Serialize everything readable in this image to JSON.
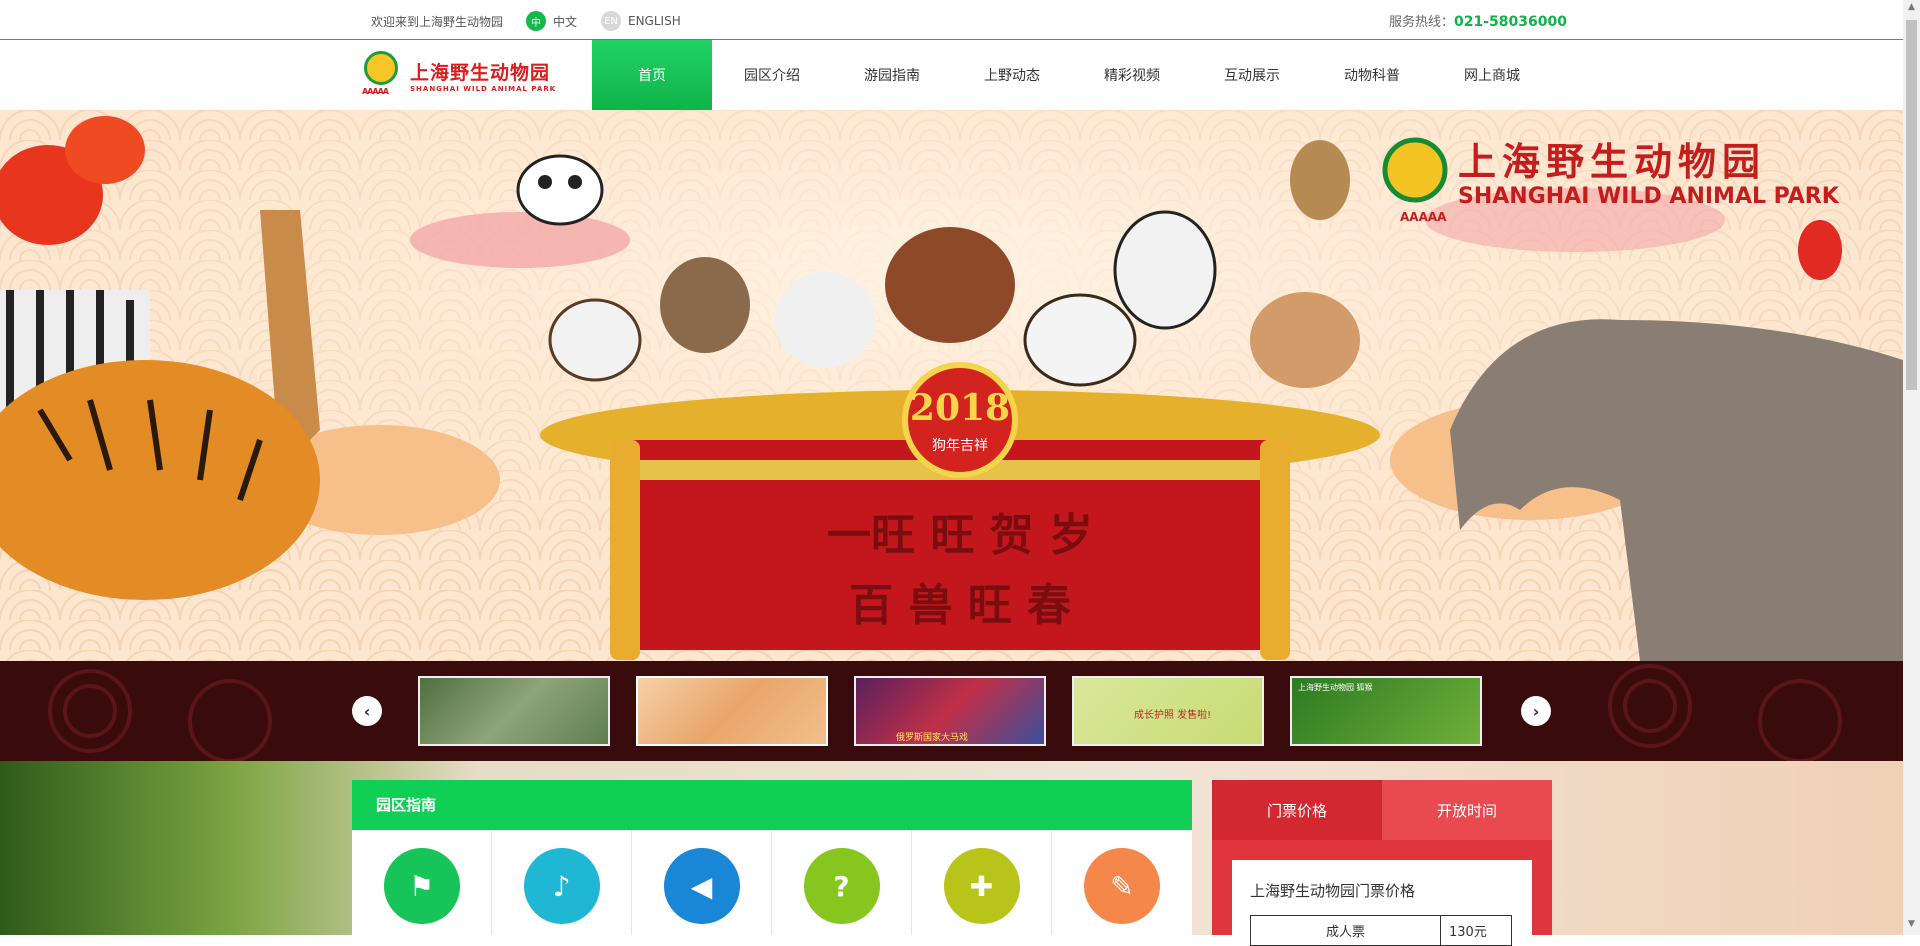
{
  "topbar": {
    "welcome": "欢迎来到上海野生动物园",
    "lang_zh_icon": "中",
    "lang_zh": "中文",
    "lang_en_icon": "EN",
    "lang_en": "ENGLISH",
    "hotline_label": "服务热线：",
    "hotline_number": "021-58036000"
  },
  "logo": {
    "cn": "上海野生动物园",
    "en": "SHANGHAI WILD ANIMAL PARK",
    "rating": "AAAAA"
  },
  "nav": {
    "items": [
      {
        "label": "首页",
        "active": true
      },
      {
        "label": "园区介绍"
      },
      {
        "label": "游园指南"
      },
      {
        "label": "上野动态"
      },
      {
        "label": "精彩视频"
      },
      {
        "label": "互动展示"
      },
      {
        "label": "动物科普"
      },
      {
        "label": "网上商城"
      }
    ]
  },
  "banner": {
    "park_name_cn": "上海野生动物园",
    "park_name_en": "SHANGHAI WILD ANIMAL PARK",
    "rating": "AAAAA",
    "year": "2018",
    "year_sub": "狗年吉祥",
    "slogan_1": "一旺 旺 贺 岁",
    "slogan_2": "百 兽 旺 春"
  },
  "thumbnails": {
    "icons": {
      "prev": "chevron-left-icon",
      "next": "chevron-right-icon"
    },
    "items": [
      {
        "color": "#6b8a5a"
      },
      {
        "color": "#f1c7a1",
        "selected": true
      },
      {
        "color": "#a52a4a",
        "caption": "俄罗斯国家大马戏"
      },
      {
        "color": "#c9dc7e",
        "caption": "成长护照 发售啦!"
      },
      {
        "color": "#3e8f2c",
        "caption": "上海野生动物园 狐猴"
      }
    ]
  },
  "guide": {
    "title": "园区指南",
    "icons": [
      {
        "name": "guide-icon",
        "color": "#16c45a"
      },
      {
        "name": "bell-icon",
        "color": "#1fb7d4"
      },
      {
        "name": "megaphone-icon",
        "color": "#1a86d6"
      },
      {
        "name": "help-icon",
        "color": "#86c61f"
      },
      {
        "name": "signpost-icon",
        "color": "#b8c41a"
      },
      {
        "name": "ticket-icon",
        "color": "#f5874a"
      }
    ]
  },
  "ticket": {
    "tab_price": "门票价格",
    "tab_hours": "开放时间",
    "card_title": "上海野生动物园门票价格",
    "row1_label": "成人票",
    "row1_value": "130元"
  },
  "colors": {
    "brand_green": "#13b94a",
    "guide_green": "#0fcf54",
    "ticket_red": "#e0353c"
  }
}
